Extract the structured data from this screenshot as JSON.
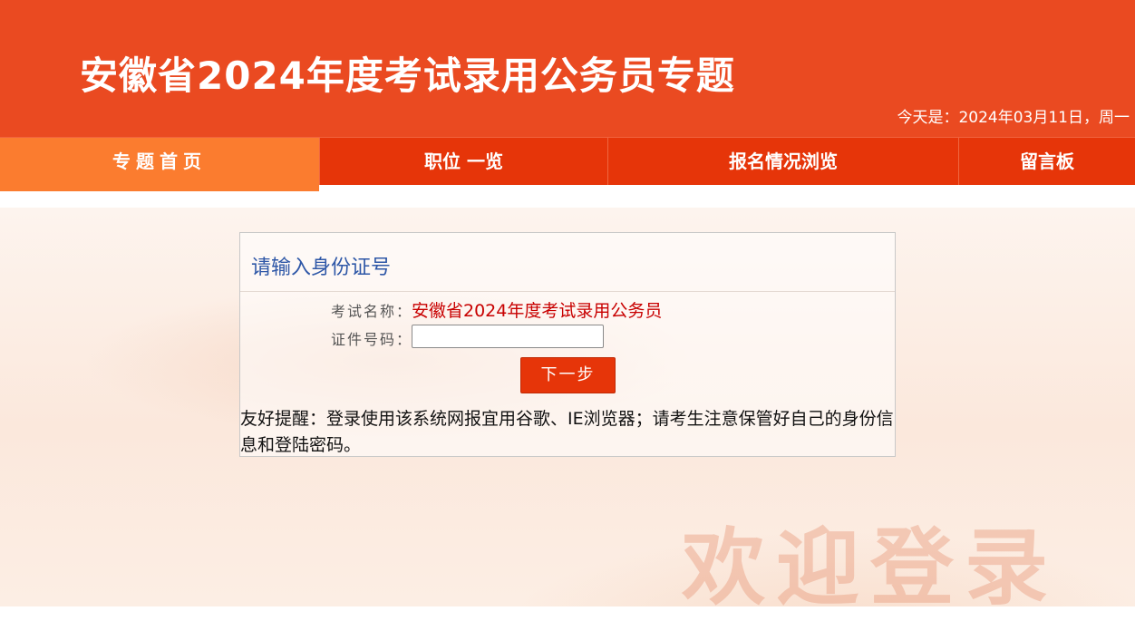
{
  "header": {
    "title": "安徽省2024年度考试录用公务员专题",
    "today": "今天是：2024年03月11日，周一"
  },
  "nav": {
    "items": [
      {
        "label": "专题首页"
      },
      {
        "label": "职位 一览"
      },
      {
        "label": "报名情况浏览"
      },
      {
        "label": "留言板"
      }
    ],
    "active_index": 0
  },
  "form": {
    "title": "请输入身份证号",
    "exam_name_label": "考试名称：",
    "exam_name_value": "安徽省2024年度考试录用公务员",
    "id_label": "证件号码：",
    "id_value": "",
    "next_button": "下一步",
    "tip": "友好提醒：登录使用该系统网报宜用谷歌、IE浏览器；请考生注意保管好自己的身份信息和登陆密码。"
  },
  "background": {
    "watermark": "欢迎登录"
  },
  "colors": {
    "header_bg": "#ea4a21",
    "nav_bg": "#e63509",
    "nav_active": "#fb7c2f",
    "title_blue": "#2e57a7",
    "exam_red": "#c80000"
  }
}
